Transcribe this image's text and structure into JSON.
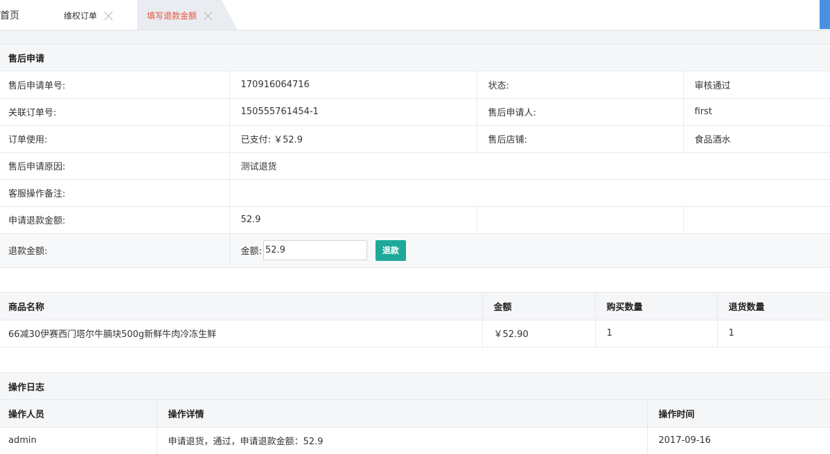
{
  "tabs": {
    "home": "首页",
    "order": "维权订单",
    "active": "填写退款金额"
  },
  "after_sale": {
    "title": "售后申请",
    "rows": [
      {
        "k1": "售后申请单号:",
        "v1": "170916064716",
        "k2": "状态:",
        "v2": "审核通过"
      },
      {
        "k1": "关联订单号:",
        "v1": "150555761454-1",
        "k2": "售后申请人:",
        "v2": "first"
      },
      {
        "k1": "订单使用:",
        "v1": "已支付: ￥52.9",
        "k2": "售后店铺:",
        "v2": "食品酒水"
      }
    ],
    "reason_label": "售后申请原因:",
    "reason_value": "测试退货",
    "remark_label": "客服操作备注:",
    "remark_value": "",
    "apply_amount_label": "申请退款金额:",
    "apply_amount_value": "52.9",
    "refund_label": "退款金额:",
    "amount_label": "金额:",
    "amount_value": "52.9",
    "refund_button": "退款"
  },
  "goods": {
    "headers": {
      "name": "商品名称",
      "amount": "金额",
      "buy_qty": "购买数量",
      "return_qty": "退货数量"
    },
    "rows": [
      {
        "name": "66减30伊赛西门塔尔牛腩块500g新鲜牛肉冷冻生鲜",
        "amount": "￥52.90",
        "buy_qty": "1",
        "return_qty": "1"
      }
    ]
  },
  "log": {
    "title": "操作日志",
    "headers": {
      "operator": "操作人员",
      "detail": "操作详情",
      "time": "操作时间"
    },
    "rows": [
      {
        "operator": "admin",
        "detail": "申请退货，通过，申请退款金额：52.9",
        "time": "2017-09-16"
      }
    ]
  },
  "colors": {
    "active_tab_text": "#e8523f",
    "refund_button": "#1ea89a",
    "accent_blue": "#4a90e2"
  }
}
